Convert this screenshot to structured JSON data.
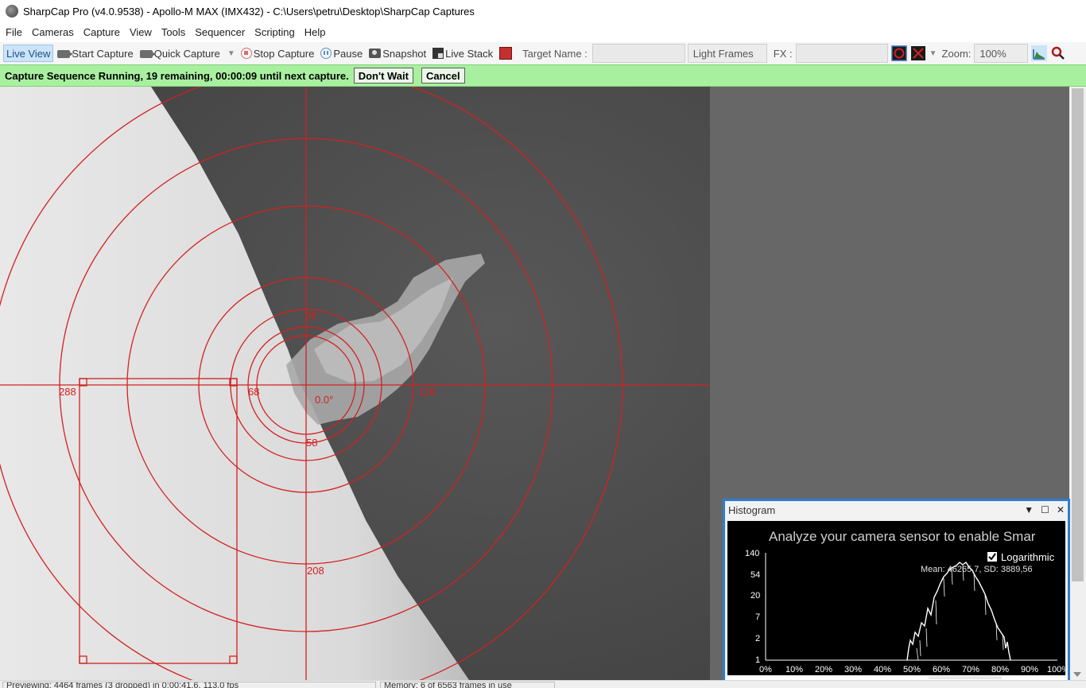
{
  "window": {
    "title": "SharpCap Pro (v4.0.9538) - Apollo-M MAX (IMX432) - C:\\Users\\petru\\Desktop\\SharpCap Captures"
  },
  "menu": [
    "File",
    "Cameras",
    "Capture",
    "View",
    "Tools",
    "Sequencer",
    "Scripting",
    "Help"
  ],
  "toolbar": {
    "live_view": "Live View",
    "start_capture": "Start Capture",
    "quick_capture": "Quick Capture",
    "stop_capture": "Stop Capture",
    "pause": "Pause",
    "snapshot": "Snapshot",
    "live_stack": "Live Stack",
    "target_name_label": "Target Name :",
    "target_name_value": "",
    "frame_type": "Light Frames",
    "fx_label": "FX :",
    "zoom_label": "Zoom:",
    "zoom_value": "100%"
  },
  "sequence": {
    "message": "Capture Sequence Running, 19 remaining, 00:00:09 until next capture.",
    "dont_wait": "Don't Wait",
    "cancel": "Cancel"
  },
  "reticle": {
    "labels": {
      "top_inner": "58",
      "bottom_inner": "58",
      "left_small": "68",
      "right_mid": "128",
      "left_far": "288",
      "bottom_far": "208",
      "center_angle": "0.0°"
    },
    "color": "#d42020"
  },
  "histogram": {
    "title": "Histogram",
    "banner": "Analyze your camera sensor to enable Smar",
    "logarithmic_label": "Logarithmic",
    "logarithmic_checked": true,
    "stats": "Mean: 46265,7, SD: 3889,56",
    "y_ticks": [
      "140",
      "54",
      "20",
      "7",
      "2",
      "1"
    ],
    "x_ticks": [
      "0%",
      "10%",
      "20%",
      "30%",
      "40%",
      "50%",
      "60%",
      "70%",
      "80%",
      "90%",
      "100%"
    ]
  },
  "statusbar": {
    "left": "Previewing: 4464 frames (3 dropped) in 0:00:41.6, 113.0 fps",
    "right": "Memory: 6 of 6563 frames in use"
  }
}
